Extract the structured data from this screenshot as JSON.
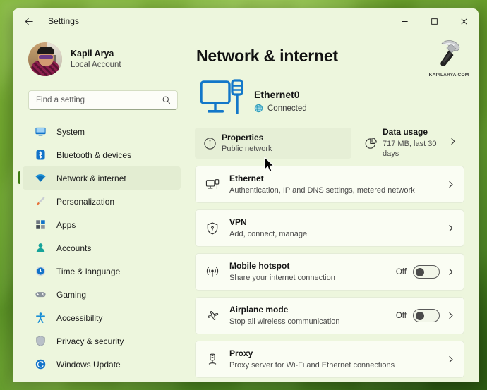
{
  "window": {
    "title": "Settings",
    "back_label": "Back",
    "minimize_label": "Minimize",
    "maximize_label": "Maximize",
    "close_label": "Close"
  },
  "account": {
    "name": "Kapil Arya",
    "subtitle": "Local Account"
  },
  "search": {
    "placeholder": "Find a setting",
    "value": ""
  },
  "sidebar": {
    "items": [
      {
        "label": "System",
        "icon": "monitor-icon",
        "selected": false
      },
      {
        "label": "Bluetooth & devices",
        "icon": "bluetooth-icon",
        "selected": false
      },
      {
        "label": "Network & internet",
        "icon": "wifi-icon",
        "selected": true
      },
      {
        "label": "Personalization",
        "icon": "paintbrush-icon",
        "selected": false
      },
      {
        "label": "Apps",
        "icon": "apps-icon",
        "selected": false
      },
      {
        "label": "Accounts",
        "icon": "person-icon",
        "selected": false
      },
      {
        "label": "Time & language",
        "icon": "clock-icon",
        "selected": false
      },
      {
        "label": "Gaming",
        "icon": "gamepad-icon",
        "selected": false
      },
      {
        "label": "Accessibility",
        "icon": "accessibility-icon",
        "selected": false
      },
      {
        "label": "Privacy & security",
        "icon": "shield-icon",
        "selected": false
      },
      {
        "label": "Windows Update",
        "icon": "update-icon",
        "selected": false
      }
    ]
  },
  "main": {
    "page_title": "Network & internet",
    "status": {
      "adapter_name": "Ethernet0",
      "connection_state": "Connected",
      "icon": "ethernet-monitor-icon",
      "globe_icon": "globe-icon"
    },
    "watermark": {
      "icon": "hammer-icon",
      "text": "KAPILARYA.COM"
    },
    "quick_actions": [
      {
        "title": "Properties",
        "subtitle": "Public network",
        "icon": "info-icon",
        "hovered": true,
        "chevron": false
      },
      {
        "title": "Data usage",
        "subtitle": "717 MB, last 30 days",
        "icon": "pie-chart-icon",
        "hovered": false,
        "chevron": true
      }
    ],
    "cards": [
      {
        "title": "Ethernet",
        "subtitle": "Authentication, IP and DNS settings, metered network",
        "icon": "ethernet-icon",
        "has_toggle": false,
        "toggle_state": "",
        "chevron": true
      },
      {
        "title": "VPN",
        "subtitle": "Add, connect, manage",
        "icon": "vpn-shield-icon",
        "has_toggle": false,
        "toggle_state": "",
        "chevron": true
      },
      {
        "title": "Mobile hotspot",
        "subtitle": "Share your internet connection",
        "icon": "hotspot-icon",
        "has_toggle": true,
        "toggle_state": "Off",
        "chevron": true
      },
      {
        "title": "Airplane mode",
        "subtitle": "Stop all wireless communication",
        "icon": "airplane-icon",
        "has_toggle": true,
        "toggle_state": "Off",
        "chevron": true
      },
      {
        "title": "Proxy",
        "subtitle": "Proxy server for Wi-Fi and Ethernet connections",
        "icon": "proxy-icon",
        "has_toggle": false,
        "toggle_state": "",
        "chevron": true
      }
    ]
  },
  "colors": {
    "window_bg": "#edf6dd",
    "card_bg": "#fafdf3",
    "accent_bar": "#3f7d13",
    "selected_nav_bg": "#e3edd2",
    "link_blue": "#0a72c4"
  }
}
